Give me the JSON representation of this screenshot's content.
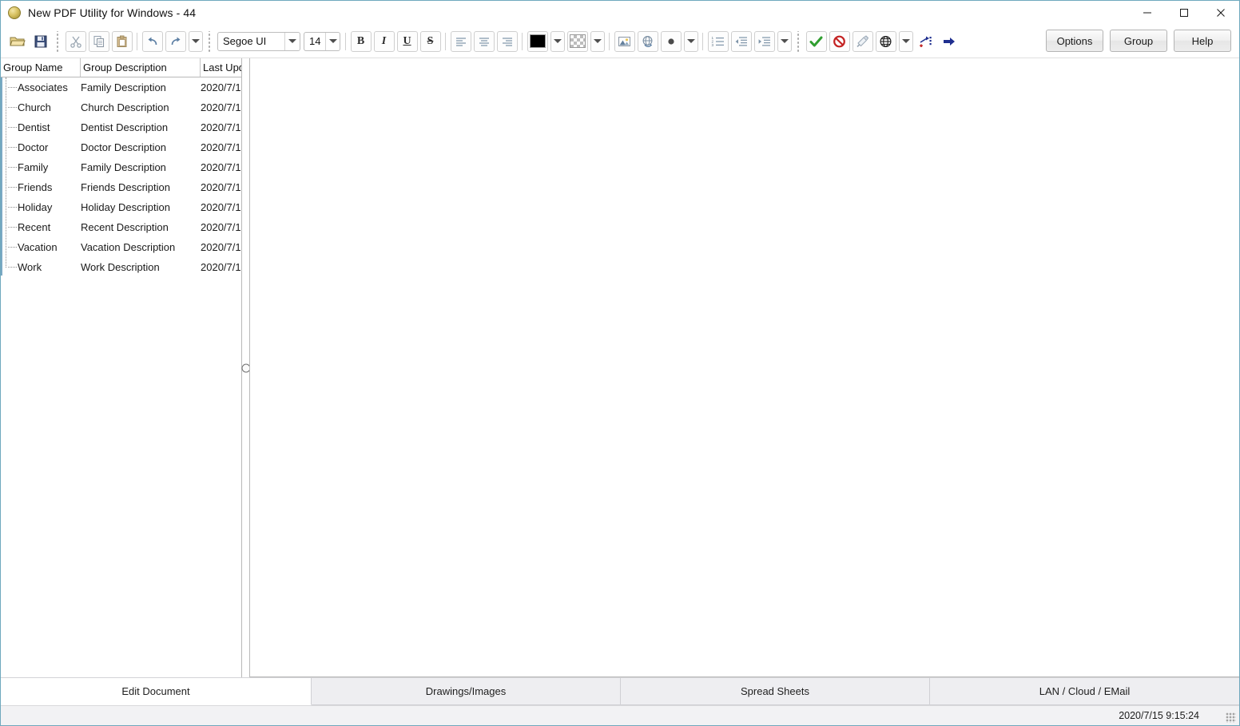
{
  "window": {
    "title": "New PDF Utility for Windows - 44",
    "icon": "app-circle-icon",
    "controls": {
      "minimize": "minimize-icon",
      "maximize": "maximize-icon",
      "close": "close-icon"
    }
  },
  "toolbar": {
    "open_label": "open-folder-icon",
    "save_label": "save-disk-icon",
    "cut_label": "cut-scissors-icon",
    "copy_label": "copy-icon",
    "paste_label": "paste-icon",
    "undo_label": "undo-icon",
    "redo_label": "redo-icon",
    "font_family": "Segoe UI",
    "font_size": "14",
    "bold_label": "B",
    "italic_label": "I",
    "underline_label": "U",
    "strike_label": "S",
    "align_left_label": "align-left-icon",
    "align_center_label": "align-center-icon",
    "align_right_label": "align-right-icon",
    "text_color": "#000000",
    "highlight_color": "transparent",
    "image_label": "insert-image-icon",
    "hyperlink_label": "hyperlink-icon",
    "bullet_label": "bullet-icon",
    "numbered_list_label": "numbered-list-icon",
    "outdent_label": "outdent-icon",
    "indent_label": "indent-icon",
    "accept_label": "check-icon",
    "cancel_label": "deny-icon",
    "spell_label": "spellcheck-icon",
    "globe_label": "globe-icon",
    "nav_add_label": "add-node-icon",
    "nav_next_label": "arrow-right-icon",
    "buttons": {
      "options": "Options",
      "group": "Group",
      "help": "Help"
    }
  },
  "list": {
    "columns": [
      "Group Name",
      "Group Description",
      "Last Upd"
    ],
    "rows": [
      {
        "name": "Associates",
        "description": "Family Description",
        "updated": "2020/7/1"
      },
      {
        "name": "Church",
        "description": "Church Description",
        "updated": "2020/7/1"
      },
      {
        "name": "Dentist",
        "description": "Dentist Description",
        "updated": "2020/7/1"
      },
      {
        "name": "Doctor",
        "description": "Doctor Description",
        "updated": "2020/7/1"
      },
      {
        "name": "Family",
        "description": "Family Description",
        "updated": "2020/7/1"
      },
      {
        "name": "Friends",
        "description": "Friends Description",
        "updated": "2020/7/1"
      },
      {
        "name": "Holiday",
        "description": "Holiday Description",
        "updated": "2020/7/1"
      },
      {
        "name": "Recent",
        "description": "Recent Description",
        "updated": "2020/7/1"
      },
      {
        "name": "Vacation",
        "description": "Vacation Description",
        "updated": "2020/7/1"
      },
      {
        "name": "Work",
        "description": "Work Description",
        "updated": "2020/7/1"
      }
    ]
  },
  "editor": {
    "content": ""
  },
  "tabs": [
    {
      "label": "Edit Document",
      "active": true
    },
    {
      "label": "Drawings/Images",
      "active": false
    },
    {
      "label": "Spread Sheets",
      "active": false
    },
    {
      "label": "LAN / Cloud / EMail",
      "active": false
    }
  ],
  "status": {
    "timestamp": "2020/7/15 9:15:24",
    "grip": "resize-grip-icon"
  }
}
